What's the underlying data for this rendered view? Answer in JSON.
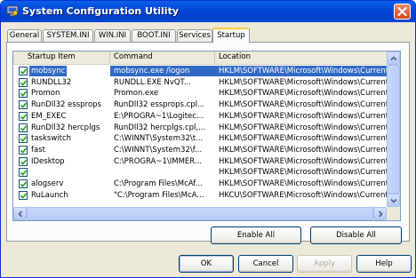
{
  "window": {
    "title": "System Configuration Utility",
    "icon": "system-config-app-icon"
  },
  "tabs": [
    {
      "label": "General",
      "active": false
    },
    {
      "label": "SYSTEM.INI",
      "active": false
    },
    {
      "label": "WIN.INI",
      "active": false
    },
    {
      "label": "BOOT.INI",
      "active": false
    },
    {
      "label": "Services",
      "active": false
    },
    {
      "label": "Startup",
      "active": true
    }
  ],
  "listview": {
    "columns": [
      "Startup Item",
      "Command",
      "Location"
    ],
    "rows": [
      {
        "item": "mobsync",
        "command": "mobsync.exe /logon",
        "location": "HKLM\\SOFTWARE\\Microsoft\\Windows\\CurrentVer...",
        "checked": true,
        "selected": true
      },
      {
        "item": "RUNDLL32",
        "command": "RUNDLL.EXE NvQT...",
        "location": "HKLM\\SOFTWARE\\Microsoft\\Windows\\CurrentVer...",
        "checked": true,
        "selected": false
      },
      {
        "item": "Promon",
        "command": "Promon.exe",
        "location": "HKLM\\SOFTWARE\\Microsoft\\Windows\\CurrentVer...",
        "checked": true,
        "selected": false
      },
      {
        "item": "RunDll32 essprops",
        "command": "RunDll32 essprops.cpl...",
        "location": "HKLM\\SOFTWARE\\Microsoft\\Windows\\CurrentVer...",
        "checked": true,
        "selected": false
      },
      {
        "item": "EM_EXEC",
        "command": "E:\\PROGRA~1\\Logitec...",
        "location": "HKLM\\SOFTWARE\\Microsoft\\Windows\\CurrentVer...",
        "checked": true,
        "selected": false
      },
      {
        "item": "RunDll32 hercplgs",
        "command": "RunDll32 hercplgs.cpl,...",
        "location": "HKLM\\SOFTWARE\\Microsoft\\Windows\\CurrentVer...",
        "checked": true,
        "selected": false
      },
      {
        "item": "taskswitch",
        "command": "C:\\WINNT\\System32\\t...",
        "location": "HKLM\\SOFTWARE\\Microsoft\\Windows\\CurrentVer...",
        "checked": true,
        "selected": false
      },
      {
        "item": "fast",
        "command": "C:\\WINNT\\System32\\f...",
        "location": "HKLM\\SOFTWARE\\Microsoft\\Windows\\CurrentVer...",
        "checked": true,
        "selected": false
      },
      {
        "item": "IDesktop",
        "command": "C:\\PROGRA~1\\IMMER...",
        "location": "HKLM\\SOFTWARE\\Microsoft\\Windows\\CurrentVer...",
        "checked": true,
        "selected": false
      },
      {
        "item": "",
        "command": "",
        "location": "HKLM\\SOFTWARE\\Microsoft\\Windows\\CurrentVer...",
        "checked": true,
        "selected": false
      },
      {
        "item": "alogserv",
        "command": "C:\\Program Files\\McAf...",
        "location": "HKLM\\SOFTWARE\\Microsoft\\Windows\\CurrentVer...",
        "checked": true,
        "selected": false
      },
      {
        "item": "RuLaunch",
        "command": "\"C:\\Program Files\\McA...",
        "location": "HKCU\\SOFTWARE\\Microsoft\\Windows\\CurrentVer...",
        "checked": true,
        "selected": false
      }
    ]
  },
  "buttons": {
    "enable_all": "Enable All",
    "disable_all": "Disable All",
    "ok": "OK",
    "cancel": "Cancel",
    "apply": "Apply",
    "help": "Help"
  },
  "colors": {
    "titlebar": "#0446d8",
    "selection": "#316ac5",
    "active_tab_accent": "#ffc83c",
    "close_button": "#d5491f"
  }
}
